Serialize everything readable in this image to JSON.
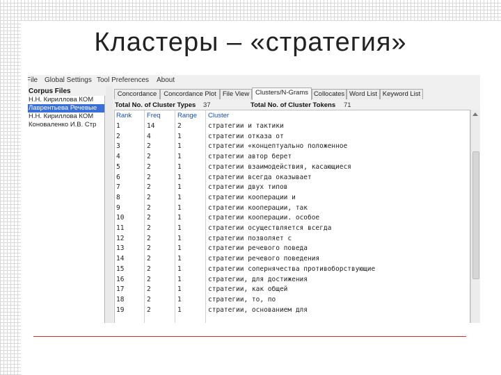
{
  "slide": {
    "title": "Кластеры – «стратегия»"
  },
  "menu": [
    "File",
    "Global Settings",
    "Tool Preferences",
    "About"
  ],
  "corpus": {
    "title": "Corpus Files",
    "files": [
      {
        "name": "Н.Н. Кириллова КОМ",
        "selected": false
      },
      {
        "name": "Лаврентьева Речевые",
        "selected": true
      },
      {
        "name": "Н.Н. Кириллова КОМ",
        "selected": false
      },
      {
        "name": "Коновален­ко И.В. Стр",
        "selected": false
      }
    ]
  },
  "tabs": [
    {
      "label": "Concordance",
      "active": false
    },
    {
      "label": "Concordance Plot",
      "active": false
    },
    {
      "label": "File View",
      "active": false
    },
    {
      "label": "Clusters/N-Grams",
      "active": true
    },
    {
      "label": "Collocates",
      "active": false
    },
    {
      "label": "Word List",
      "active": false
    },
    {
      "label": "Keyword List",
      "active": false
    }
  ],
  "stats": {
    "types_label": "Total No. of Cluster Types",
    "types_value": "37",
    "tokens_label": "Total No. of Cluster Tokens",
    "tokens_value": "71"
  },
  "table": {
    "headers": [
      "Rank",
      "Freq",
      "Range",
      "Cluster"
    ],
    "rows": [
      [
        "1",
        "14",
        "2",
        "стратегии и тактики"
      ],
      [
        "2",
        "4",
        "1",
        "стратегии отказа от"
      ],
      [
        "3",
        "2",
        "1",
        "стратегии «концептуально положенное"
      ],
      [
        "4",
        "2",
        "1",
        "стратегии автор берет"
      ],
      [
        "5",
        "2",
        "1",
        "стратегии взаимодействия, касающиеся"
      ],
      [
        "6",
        "2",
        "1",
        "стратегии всегда оказывает"
      ],
      [
        "7",
        "2",
        "1",
        "стратегии двух типов"
      ],
      [
        "8",
        "2",
        "1",
        "стратегии кооперации и"
      ],
      [
        "9",
        "2",
        "1",
        "стратегии кооперации, так"
      ],
      [
        "10",
        "2",
        "1",
        "стратегии кооперации. особое"
      ],
      [
        "11",
        "2",
        "1",
        "стратегии осуществляется всегда"
      ],
      [
        "12",
        "2",
        "1",
        "стратегии позволяет с"
      ],
      [
        "13",
        "2",
        "1",
        "стратегии речевого поведа"
      ],
      [
        "14",
        "2",
        "1",
        "стратегии речевого поведения"
      ],
      [
        "15",
        "2",
        "1",
        "стратегии сопернячества противоборствующие"
      ],
      [
        "16",
        "2",
        "1",
        "стратегии, для достижения"
      ],
      [
        "17",
        "2",
        "1",
        "стратегии, как общей"
      ],
      [
        "18",
        "2",
        "1",
        "стратегии, то, по"
      ],
      [
        "19",
        "2",
        "1",
        "стратегии, основанием для"
      ]
    ]
  },
  "colors": {
    "selection": "#3a6fd8",
    "header_text": "#1a4fb0",
    "rule": "#c53030"
  }
}
